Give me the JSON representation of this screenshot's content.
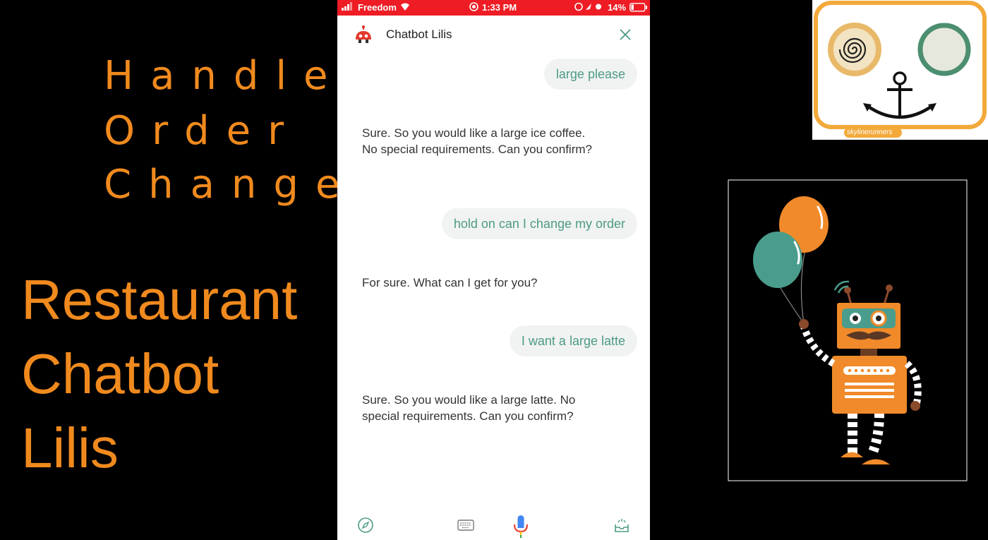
{
  "promo": {
    "line1": "Handle",
    "line2": "Order",
    "line3": "Change",
    "big1": "Restaurant",
    "big2": "Chatbot",
    "big3": "Lilis",
    "accent_color": "#f08a1e"
  },
  "status_bar": {
    "carrier": "Freedom",
    "time": "1:33 PM",
    "battery": "14%",
    "color": "#ee1c24"
  },
  "chat": {
    "title": "Chatbot Lilis",
    "messages": [
      {
        "from": "user",
        "text": "large please"
      },
      {
        "from": "bot",
        "text": "Sure. So you would like a large ice coffee.                      No special requirements. Can you confirm?"
      },
      {
        "from": "user",
        "text": "hold on can I change my order"
      },
      {
        "from": "bot",
        "text": "For sure. What can I get for you?"
      },
      {
        "from": "user",
        "text": "I want a large latte"
      },
      {
        "from": "bot",
        "text": "Sure. So you would like a large latte. No special requirements. Can you confirm?"
      }
    ],
    "user_text_color": "#4e9a86",
    "user_bubble_color": "#f1f3f2"
  },
  "toolbar": {
    "icons": [
      "compass-icon",
      "keyboard-icon",
      "microphone-icon",
      "tray-icon"
    ]
  },
  "logo": {
    "caption": "skylinerunners"
  }
}
